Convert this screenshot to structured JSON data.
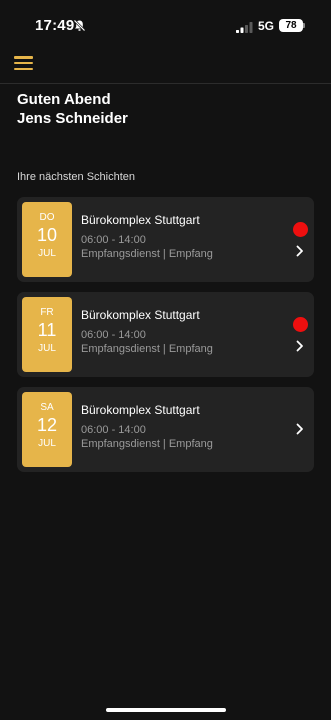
{
  "status_bar": {
    "time": "17:49",
    "network": "5G",
    "battery": "78"
  },
  "header": {
    "menu_icon": "hamburger-menu-icon"
  },
  "greeting": {
    "line1": "Guten Abend",
    "line2": "Jens Schneider"
  },
  "section_title": "Ihre nächsten Schichten",
  "colors": {
    "accent": "#e6b54a",
    "background": "#121212",
    "card": "#232323",
    "alert": "#ee0f0f"
  },
  "shifts": [
    {
      "day_of_week": "DO",
      "day": "10",
      "month": "JUL",
      "location": "Bürokomplex Stuttgart",
      "time": "06:00 - 14:00",
      "role": "Empfangsdienst | Empfang",
      "has_notification": true
    },
    {
      "day_of_week": "FR",
      "day": "11",
      "month": "JUL",
      "location": "Bürokomplex Stuttgart",
      "time": "06:00 - 14:00",
      "role": "Empfangsdienst | Empfang",
      "has_notification": true
    },
    {
      "day_of_week": "SA",
      "day": "12",
      "month": "JUL",
      "location": "Bürokomplex Stuttgart",
      "time": "06:00 - 14:00",
      "role": "Empfangsdienst | Empfang",
      "has_notification": false
    }
  ]
}
